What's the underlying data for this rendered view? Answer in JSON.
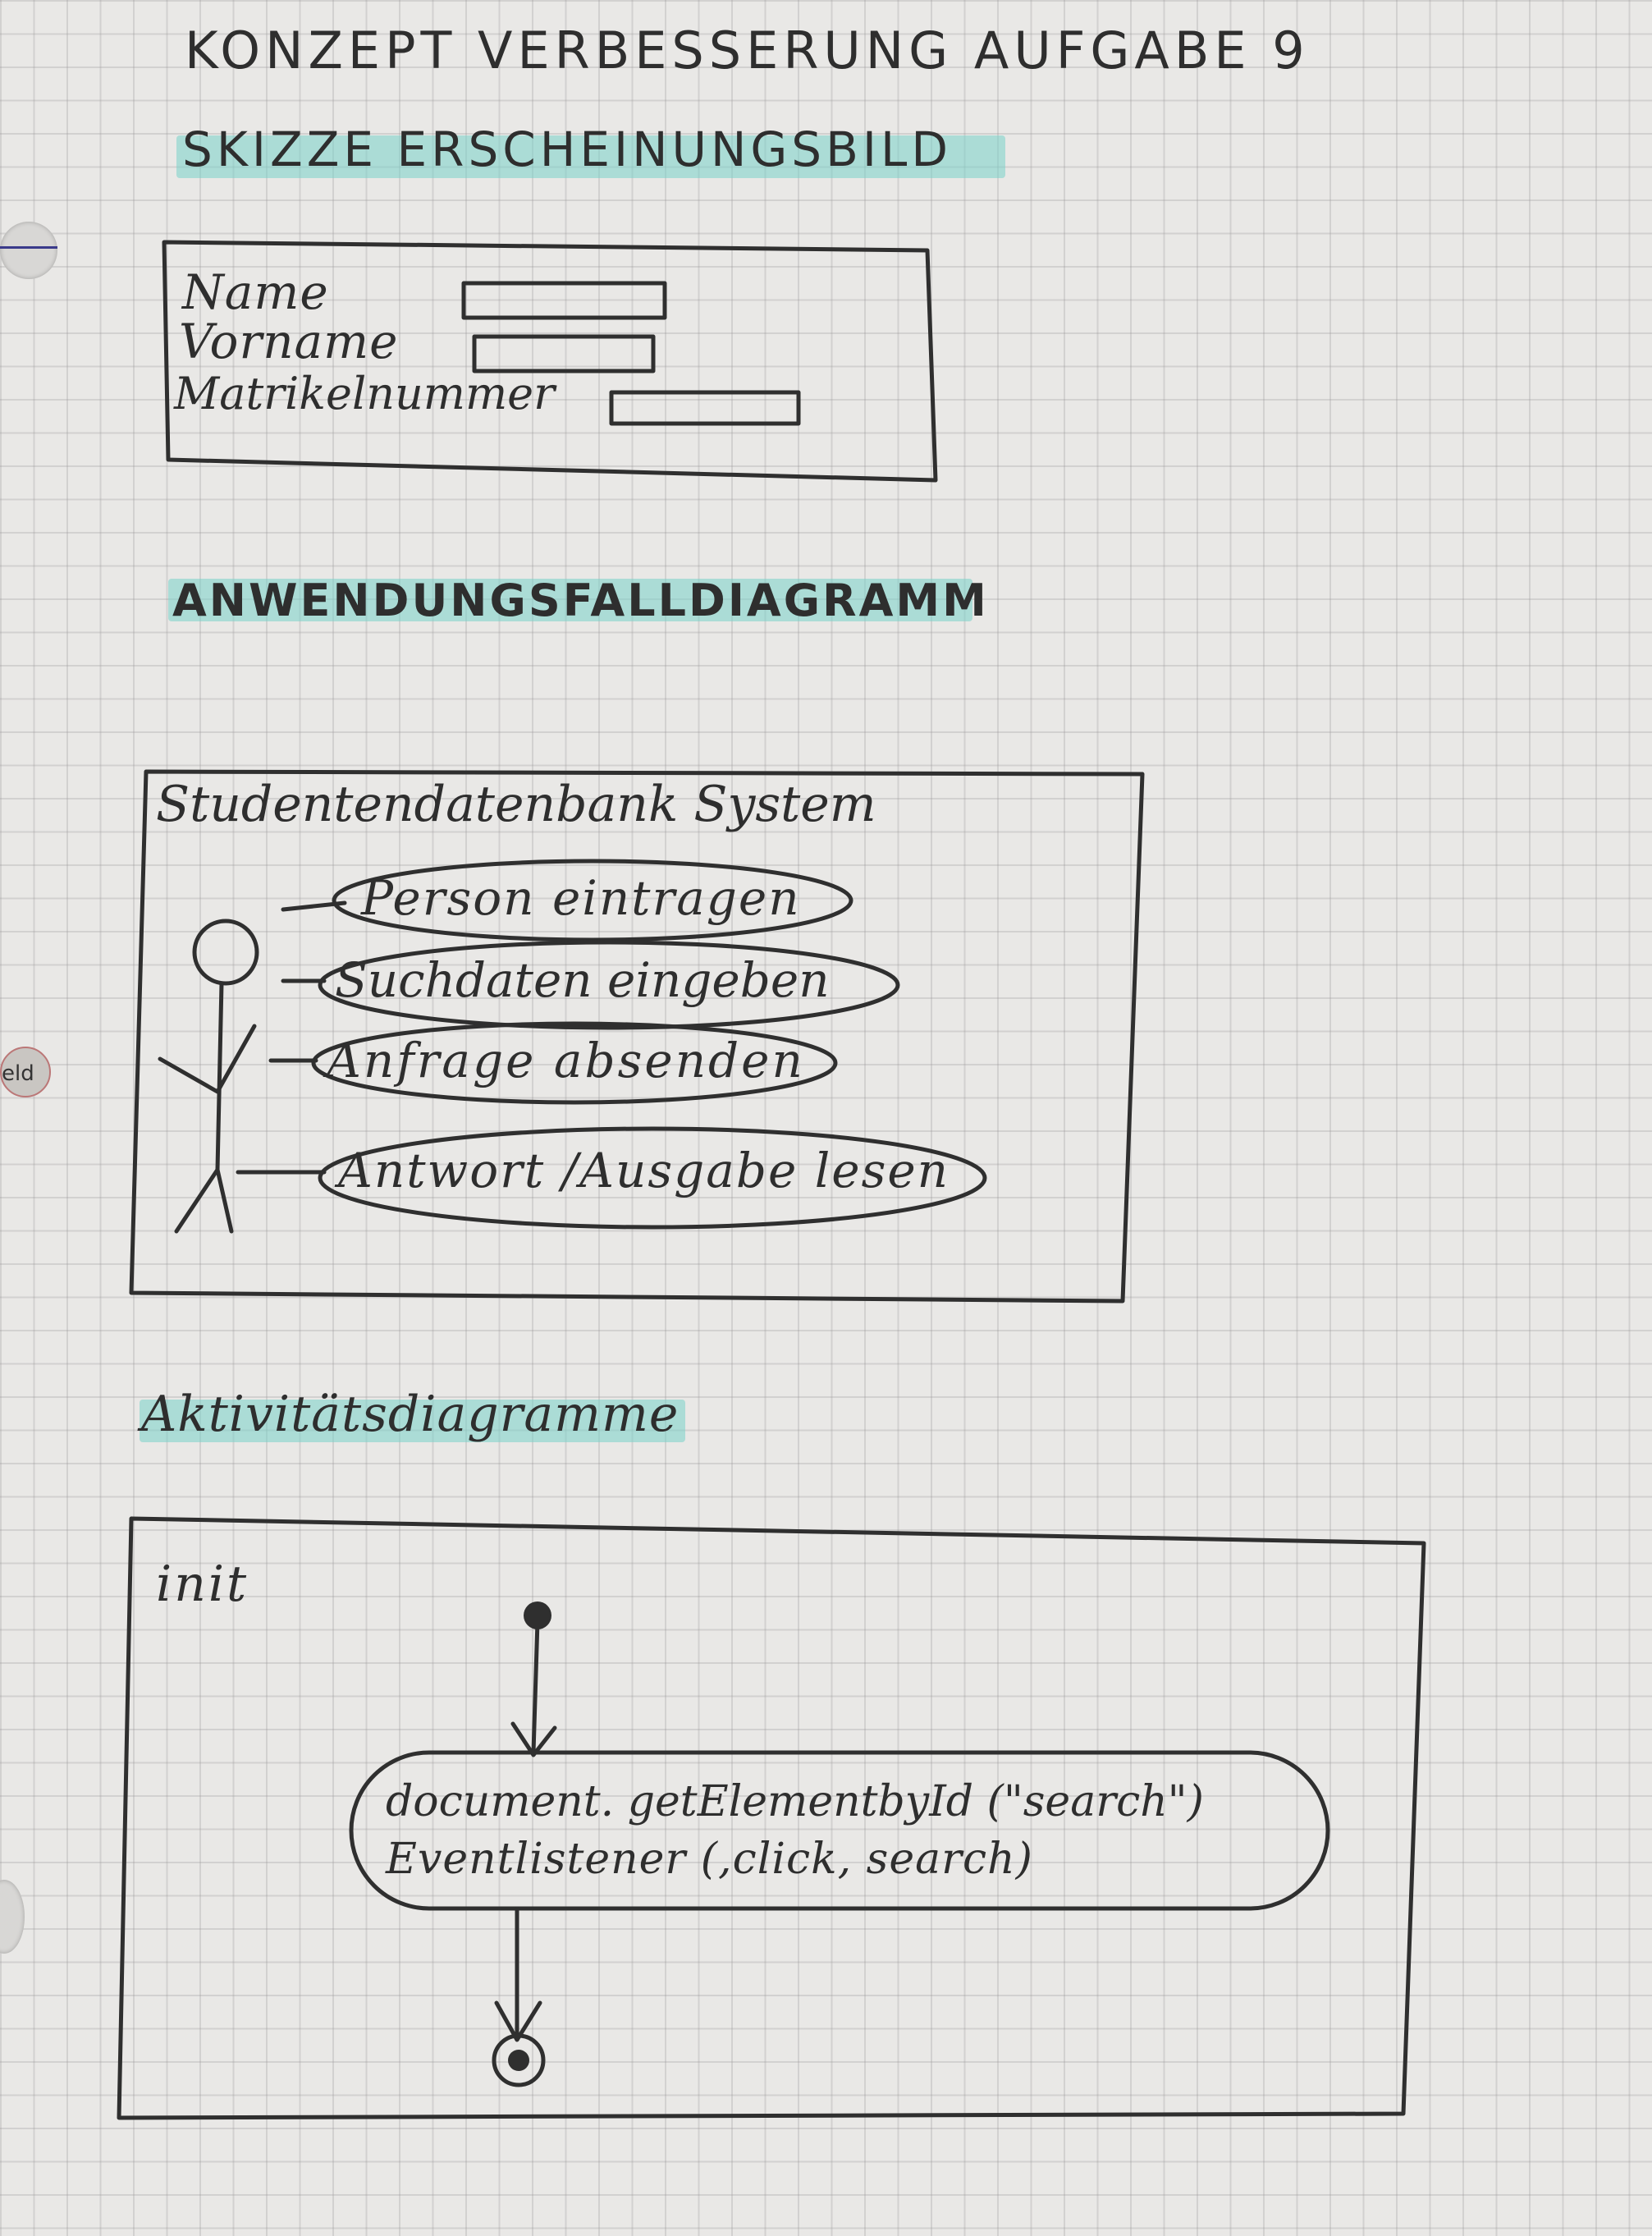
{
  "title": "KONZEPT VERBESSERUNG   AUFGABE 9",
  "sections": {
    "skizze_heading": "SKIZZE ERSCHEINUNGSBILD",
    "usecase_heading": "ANWENDUNGSFALLDIAGRAMM",
    "activity_heading": "Aktivitätsdiagramme"
  },
  "form_sketch": {
    "fields": [
      "Name",
      "Vorname",
      "Matrikelnummer"
    ]
  },
  "usecase": {
    "system_label": "Studentendatenbank  System",
    "cases": [
      "Person eintragen",
      "Suchdaten eingeben",
      "Anfrage absenden",
      "Antwort /Ausgabe lesen"
    ]
  },
  "activity": {
    "name": "init",
    "action_line1": "document. getElementbyId (\"search\")",
    "action_line2": "Eventlistener (,click, search)"
  },
  "margin_tab_label": "eld",
  "colors": {
    "highlight": "#7fd6cb",
    "ink": "#2e2e2e",
    "paper": "#e9e8e6"
  }
}
